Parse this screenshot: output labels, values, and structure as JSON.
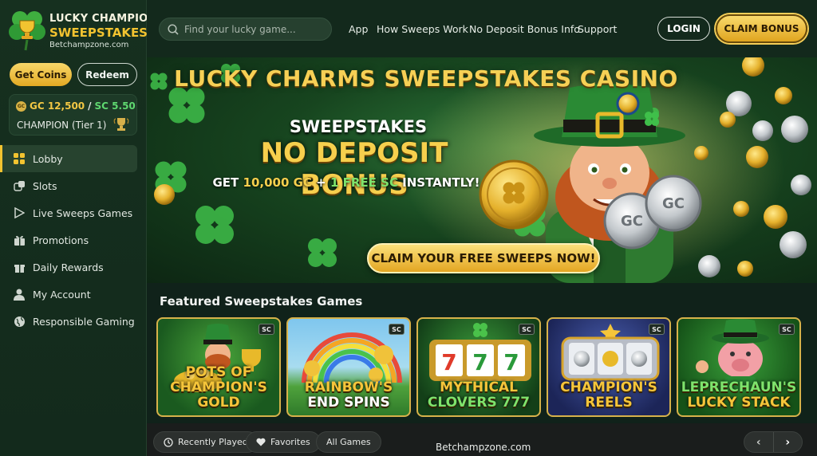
{
  "brand": {
    "line1": "LUCKY CHAMPION",
    "line2": "SWEEPSTAKES",
    "domain": "Betchampzone.com"
  },
  "wallet": {
    "get_coins": "Get Coins",
    "redeem": "Redeem",
    "gc": "GC 12,500",
    "sep": "/",
    "sc": "SC 5.50",
    "gc_coin": "GC",
    "tier": "CHAMPION (Tier 1)"
  },
  "sidebar": {
    "items": [
      {
        "label": "Lobby",
        "icon": "grid-icon",
        "active": true
      },
      {
        "label": "Slots",
        "icon": "dice-icon"
      },
      {
        "label": "Live Sweeps Games",
        "icon": "play-icon"
      },
      {
        "label": "Promotions",
        "icon": "gift-icon"
      },
      {
        "label": "Daily Rewards",
        "icon": "gift-box-icon"
      },
      {
        "label": "My Account",
        "icon": "user-icon"
      },
      {
        "label": "Responsible Gaming",
        "icon": "globe-icon"
      }
    ]
  },
  "header": {
    "search_placeholder": "Find your lucky game...",
    "links": [
      "App",
      "How Sweeps Work",
      "No Deposit Bonus Info",
      "Support"
    ],
    "login": "LOGIN",
    "claim_bonus": "CLAIM BONUS"
  },
  "hero": {
    "title": "LUCKY CHARMS SWEEPSTAKES CASINO",
    "sub1": "SWEEPSTAKES",
    "sub2": "NO DEPOSIT BONUS",
    "sub3_a": "GET ",
    "sub3_b": "10,000 GC",
    "sub3_c": " + ",
    "sub3_d": "1 FREE SC",
    "sub3_e": " INSTANTLY!",
    "coin_label": "GC",
    "cta": "CLAIM YOUR FREE SWEEPS NOW!"
  },
  "featured": {
    "title": "Featured Sweepstakes Games",
    "badge": "SC",
    "games": [
      {
        "l1": "POTS OF",
        "l2": "CHAMPION'S GOLD"
      },
      {
        "l1": "RAINBOW'S",
        "l2": "END SPINS"
      },
      {
        "l1": "MYTHICAL",
        "l2": "CLOVERS 777"
      },
      {
        "l1": "CHAMPION'S",
        "l2": "REELS"
      },
      {
        "l1": "LEPRECHAUN'S",
        "l2": "LUCKY STACK"
      }
    ]
  },
  "bottom": {
    "recent": "Recently Played",
    "favorites": "Favorites",
    "all": "All Games",
    "url": "Betchampzone.com",
    "prev": "‹",
    "next": "›"
  },
  "colors": {
    "accent_gold": "#f2c330",
    "green_bg": "#16301f",
    "sc_green": "#5fd870"
  }
}
